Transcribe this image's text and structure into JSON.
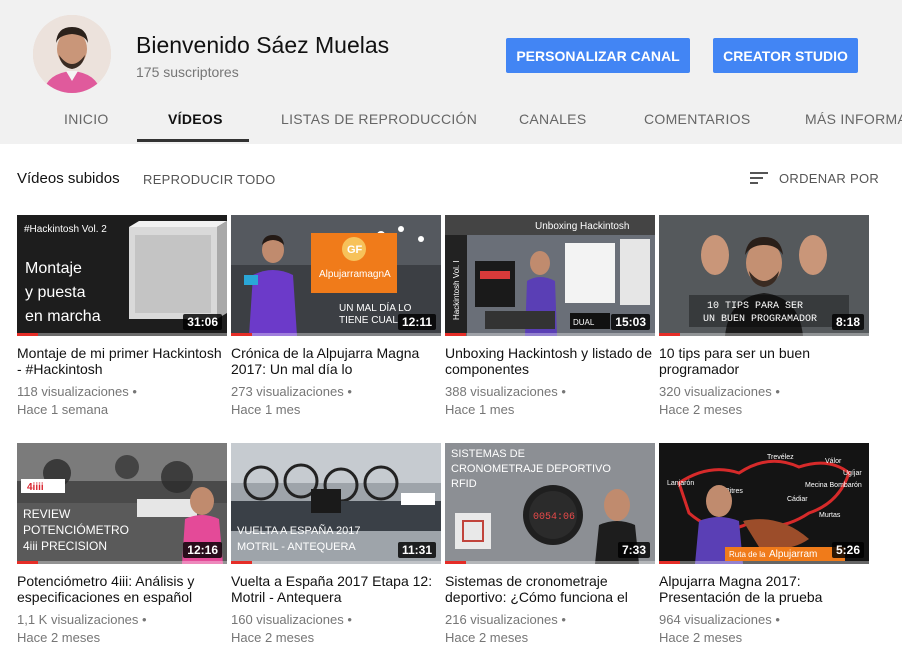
{
  "channel": {
    "name": "Bienvenido Sáez Muelas",
    "subscribers": "175 suscriptores"
  },
  "buttons": {
    "customize": "PERSONALIZAR CANAL",
    "studio": "CREATOR STUDIO"
  },
  "tabs": [
    "INICIO",
    "VÍDEOS",
    "LISTAS DE REPRODUCCIÓN",
    "CANALES",
    "COMENTARIOS",
    "MÁS INFORMACIÓN"
  ],
  "active_tab": "VÍDEOS",
  "section": {
    "title": "Vídeos subidos",
    "play_all": "REPRODUCIR TODO",
    "sort": "ORDENAR POR"
  },
  "colors": {
    "accent": "#4285f4",
    "progress": "#e52d27",
    "header_bg": "#f1f1f1"
  },
  "videos": [
    {
      "title": "Montaje de mi primer Hackintosh - #Hackintosh",
      "views": "118 visualizaciones •",
      "age": "Hace 1 semana",
      "duration": "31:06",
      "progress": 0.1,
      "thumb_text": [
        "#Hackintosh Vol. 2",
        "Montaje",
        "y puesta",
        "en marcha"
      ]
    },
    {
      "title": "Crónica de la Alpujarra Magna 2017: Un mal día lo",
      "views": "273 visualizaciones •",
      "age": "Hace 1 mes",
      "duration": "12:11",
      "progress": 0.1,
      "thumb_text": [
        "GF",
        "AlpujarramagnA",
        "UN MAL DÍA LO",
        "TIENE CUAL"
      ]
    },
    {
      "title": "Unboxing Hackintosh y listado de componentes",
      "views": "388 visualizaciones •",
      "age": "Hace 1 mes",
      "duration": "15:03",
      "progress": 0.1,
      "thumb_text": [
        "Unboxing Hackintosh",
        "Hackintosh Vol. I",
        "DUAL"
      ]
    },
    {
      "title": "10 tips para ser un buen programador",
      "views": "320 visualizaciones •",
      "age": "Hace 2 meses",
      "duration": "8:18",
      "progress": 0.1,
      "thumb_text": [
        "10 TIPS PARA SER",
        "UN BUEN PROGRAMADOR"
      ]
    },
    {
      "title": "Potenciómetro 4iii: Análisis y especificaciones en español",
      "views": "1,1 K visualizaciones •",
      "age": "Hace 2 meses",
      "duration": "12:16",
      "progress": 0.1,
      "thumb_text": [
        "4iiii",
        "REVIEW",
        "POTENCIÓMETRO",
        "4iii PRECISION"
      ]
    },
    {
      "title": "Vuelta a España 2017 Etapa 12: Motril - Antequera",
      "views": "160 visualizaciones •",
      "age": "Hace 2 meses",
      "duration": "11:31",
      "progress": 0.1,
      "thumb_text": [
        "VUELTA A ESPAÑA 2017",
        "MOTRIL - ANTEQUERA"
      ]
    },
    {
      "title": "Sistemas de cronometraje deportivo: ¿Cómo funciona el",
      "views": "216 visualizaciones •",
      "age": "Hace 2 meses",
      "duration": "7:33",
      "progress": 0.1,
      "thumb_text": [
        "SISTEMAS DE",
        "CRONOMETRAJE DEPORTIVO",
        "RFID",
        "0054:06"
      ]
    },
    {
      "title": "Alpujarra Magna 2017: Presentación de la prueba",
      "views": "964 visualizaciones •",
      "age": "Hace 2 meses",
      "duration": "5:26",
      "progress": 0.1,
      "thumb_text": [
        "Alpujarram",
        "Trevélez",
        "Lanjarón",
        "Pitres",
        "Cádiar",
        "Ugíjar",
        "Válor",
        "Mecina Bombarón",
        "Murtas",
        "Ruta de la"
      ]
    }
  ]
}
